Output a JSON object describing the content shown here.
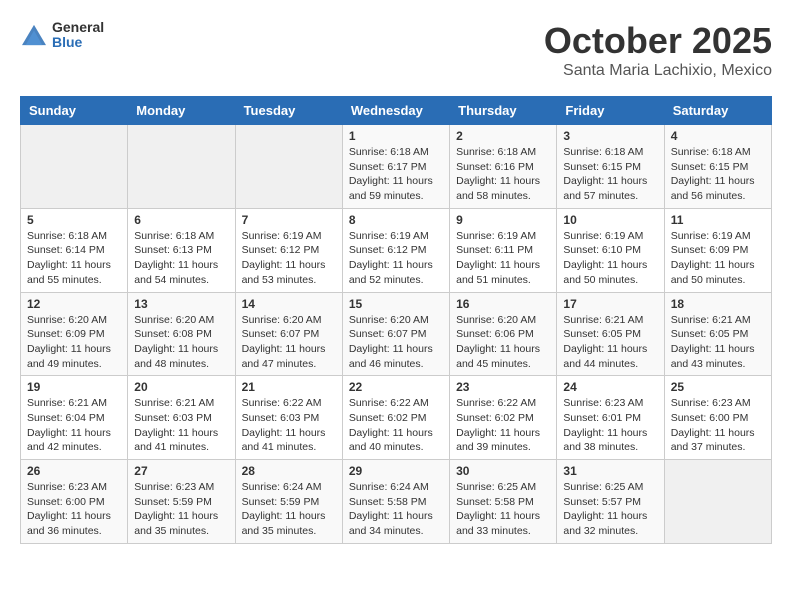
{
  "header": {
    "logo_line1": "General",
    "logo_line2": "Blue",
    "title": "October 2025",
    "subtitle": "Santa Maria Lachixio, Mexico"
  },
  "weekdays": [
    "Sunday",
    "Monday",
    "Tuesday",
    "Wednesday",
    "Thursday",
    "Friday",
    "Saturday"
  ],
  "weeks": [
    [
      {
        "day": "",
        "info": ""
      },
      {
        "day": "",
        "info": ""
      },
      {
        "day": "",
        "info": ""
      },
      {
        "day": "1",
        "info": "Sunrise: 6:18 AM\nSunset: 6:17 PM\nDaylight: 11 hours\nand 59 minutes."
      },
      {
        "day": "2",
        "info": "Sunrise: 6:18 AM\nSunset: 6:16 PM\nDaylight: 11 hours\nand 58 minutes."
      },
      {
        "day": "3",
        "info": "Sunrise: 6:18 AM\nSunset: 6:15 PM\nDaylight: 11 hours\nand 57 minutes."
      },
      {
        "day": "4",
        "info": "Sunrise: 6:18 AM\nSunset: 6:15 PM\nDaylight: 11 hours\nand 56 minutes."
      }
    ],
    [
      {
        "day": "5",
        "info": "Sunrise: 6:18 AM\nSunset: 6:14 PM\nDaylight: 11 hours\nand 55 minutes."
      },
      {
        "day": "6",
        "info": "Sunrise: 6:18 AM\nSunset: 6:13 PM\nDaylight: 11 hours\nand 54 minutes."
      },
      {
        "day": "7",
        "info": "Sunrise: 6:19 AM\nSunset: 6:12 PM\nDaylight: 11 hours\nand 53 minutes."
      },
      {
        "day": "8",
        "info": "Sunrise: 6:19 AM\nSunset: 6:12 PM\nDaylight: 11 hours\nand 52 minutes."
      },
      {
        "day": "9",
        "info": "Sunrise: 6:19 AM\nSunset: 6:11 PM\nDaylight: 11 hours\nand 51 minutes."
      },
      {
        "day": "10",
        "info": "Sunrise: 6:19 AM\nSunset: 6:10 PM\nDaylight: 11 hours\nand 50 minutes."
      },
      {
        "day": "11",
        "info": "Sunrise: 6:19 AM\nSunset: 6:09 PM\nDaylight: 11 hours\nand 50 minutes."
      }
    ],
    [
      {
        "day": "12",
        "info": "Sunrise: 6:20 AM\nSunset: 6:09 PM\nDaylight: 11 hours\nand 49 minutes."
      },
      {
        "day": "13",
        "info": "Sunrise: 6:20 AM\nSunset: 6:08 PM\nDaylight: 11 hours\nand 48 minutes."
      },
      {
        "day": "14",
        "info": "Sunrise: 6:20 AM\nSunset: 6:07 PM\nDaylight: 11 hours\nand 47 minutes."
      },
      {
        "day": "15",
        "info": "Sunrise: 6:20 AM\nSunset: 6:07 PM\nDaylight: 11 hours\nand 46 minutes."
      },
      {
        "day": "16",
        "info": "Sunrise: 6:20 AM\nSunset: 6:06 PM\nDaylight: 11 hours\nand 45 minutes."
      },
      {
        "day": "17",
        "info": "Sunrise: 6:21 AM\nSunset: 6:05 PM\nDaylight: 11 hours\nand 44 minutes."
      },
      {
        "day": "18",
        "info": "Sunrise: 6:21 AM\nSunset: 6:05 PM\nDaylight: 11 hours\nand 43 minutes."
      }
    ],
    [
      {
        "day": "19",
        "info": "Sunrise: 6:21 AM\nSunset: 6:04 PM\nDaylight: 11 hours\nand 42 minutes."
      },
      {
        "day": "20",
        "info": "Sunrise: 6:21 AM\nSunset: 6:03 PM\nDaylight: 11 hours\nand 41 minutes."
      },
      {
        "day": "21",
        "info": "Sunrise: 6:22 AM\nSunset: 6:03 PM\nDaylight: 11 hours\nand 41 minutes."
      },
      {
        "day": "22",
        "info": "Sunrise: 6:22 AM\nSunset: 6:02 PM\nDaylight: 11 hours\nand 40 minutes."
      },
      {
        "day": "23",
        "info": "Sunrise: 6:22 AM\nSunset: 6:02 PM\nDaylight: 11 hours\nand 39 minutes."
      },
      {
        "day": "24",
        "info": "Sunrise: 6:23 AM\nSunset: 6:01 PM\nDaylight: 11 hours\nand 38 minutes."
      },
      {
        "day": "25",
        "info": "Sunrise: 6:23 AM\nSunset: 6:00 PM\nDaylight: 11 hours\nand 37 minutes."
      }
    ],
    [
      {
        "day": "26",
        "info": "Sunrise: 6:23 AM\nSunset: 6:00 PM\nDaylight: 11 hours\nand 36 minutes."
      },
      {
        "day": "27",
        "info": "Sunrise: 6:23 AM\nSunset: 5:59 PM\nDaylight: 11 hours\nand 35 minutes."
      },
      {
        "day": "28",
        "info": "Sunrise: 6:24 AM\nSunset: 5:59 PM\nDaylight: 11 hours\nand 35 minutes."
      },
      {
        "day": "29",
        "info": "Sunrise: 6:24 AM\nSunset: 5:58 PM\nDaylight: 11 hours\nand 34 minutes."
      },
      {
        "day": "30",
        "info": "Sunrise: 6:25 AM\nSunset: 5:58 PM\nDaylight: 11 hours\nand 33 minutes."
      },
      {
        "day": "31",
        "info": "Sunrise: 6:25 AM\nSunset: 5:57 PM\nDaylight: 11 hours\nand 32 minutes."
      },
      {
        "day": "",
        "info": ""
      }
    ]
  ]
}
